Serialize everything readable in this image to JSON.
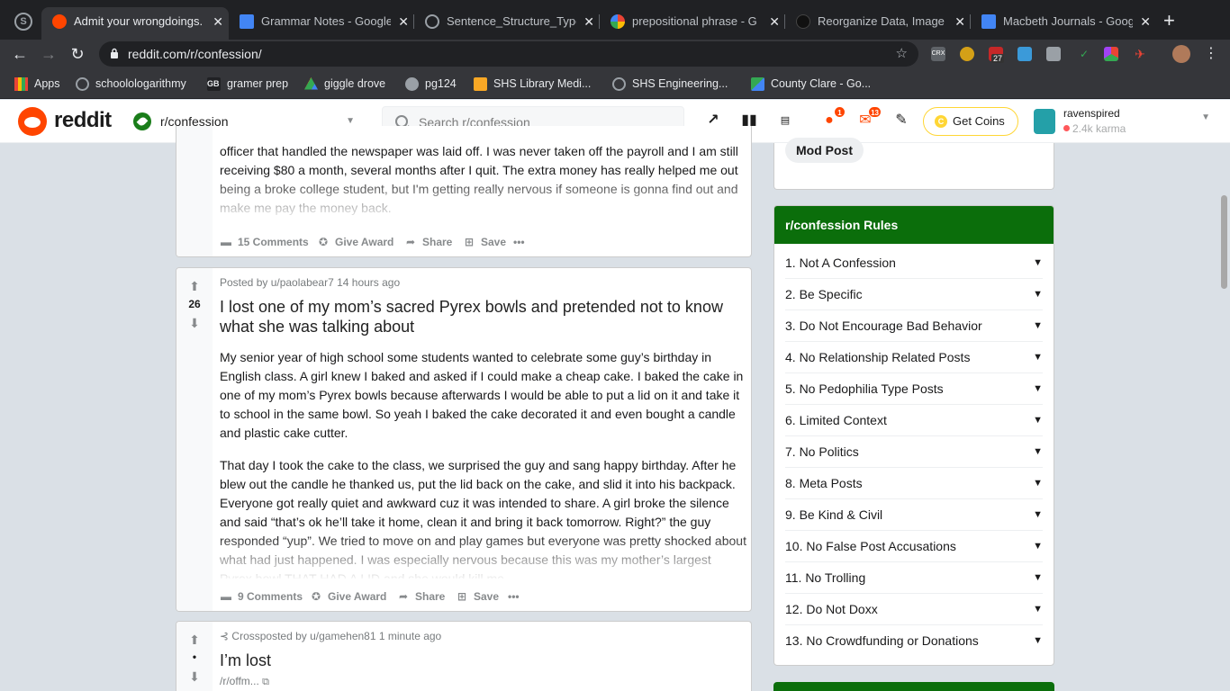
{
  "browser": {
    "tabs": [
      {
        "title": "Admit your wrongdoings.",
        "active": true,
        "favicon": "reddit-icon"
      },
      {
        "title": "Grammar Notes - Google",
        "favicon": "docs-icon"
      },
      {
        "title": "Sentence_Structure_Type",
        "favicon": "schoology-icon"
      },
      {
        "title": "prepositional phrase - G",
        "favicon": "google-icon"
      },
      {
        "title": "Reorganize Data, Image",
        "favicon": "github-icon"
      },
      {
        "title": "Macbeth Journals - Goog",
        "favicon": "docs-icon"
      }
    ],
    "url": "reddit.com/r/confession/",
    "extension_badge": "27",
    "bookmarks": [
      {
        "label": "Apps"
      },
      {
        "label": "schoolologarithmy"
      },
      {
        "label": "gramer prep"
      },
      {
        "label": "giggle drove"
      },
      {
        "label": "pg124"
      },
      {
        "label": "SHS Library Medi..."
      },
      {
        "label": "SHS Engineering..."
      },
      {
        "label": "County Clare - Go..."
      }
    ]
  },
  "header": {
    "wordmark": "reddit",
    "community": "r/confession",
    "search_placeholder": "Search r/confession",
    "chat_badge": "1",
    "mail_badge": "13",
    "get_coins": "Get Coins",
    "username": "ravenspired",
    "karma": "2.4k karma"
  },
  "feed": {
    "post1": {
      "body": "officer that handled the newspaper was laid off. I was never taken off the payroll and I am still receiving $80 a month, several months after I quit. The extra money has really helped me out being a broke college student, but I'm getting really nervous if someone is gonna find out and make me pay the money back.",
      "comments": "15 Comments",
      "award": "Give Award",
      "share": "Share",
      "save": "Save"
    },
    "post2": {
      "score": "26",
      "meta": "Posted by u/paolabear7 14 hours ago",
      "title": "I lost one of my mom’s sacred Pyrex bowls and pretended not to know what she was talking about",
      "para1": "My senior year of high school some students wanted to celebrate some guy’s birthday in English class. A girl knew I baked and asked if I could make a cheap cake. I baked the cake in one of my mom’s Pyrex bowls because afterwards I would be able to put a lid on it and take it to school in the same bowl. So yeah I baked the cake decorated it and even bought a candle and plastic cake cutter.",
      "para2": "That day I took the cake to the class, we surprised the guy and sang happy birthday. After he blew out the candle he thanked us, put the lid back on the cake, and slid it into his backpack. Everyone got really quiet and awkward cuz it was intended to share. A girl broke the silence and said “that’s ok he’ll take it home, clean it and bring it back tomorrow. Right?” the guy responded “yup”. We tried to move on and play games but everyone was pretty shocked about what had just happened. I was especially nervous because this was my mother’s largest Pyrex bowl THAT HAD A LID and she would kill me",
      "comments": "9 Comments",
      "award": "Give Award",
      "share": "Share",
      "save": "Save"
    },
    "post3": {
      "score": "•",
      "meta": "Crossposted by u/gamehen81 1 minute ago",
      "title": "I’m lost",
      "link": "/r/offm..."
    }
  },
  "sidebar": {
    "mod_post": "Mod Post",
    "rules_title": "r/confession Rules",
    "rules": [
      "1. Not A Confession",
      "2. Be Specific",
      "3. Do Not Encourage Bad Behavior",
      "4. No Relationship Related Posts",
      "5. No Pedophilia Type Posts",
      "6. Limited Context",
      "7. No Politics",
      "8. Meta Posts",
      "9. Be Kind & Civil",
      "10. No False Post Accusations",
      "11. No Trolling",
      "12. Do Not Doxx",
      "13. No Crowdfunding or Donations"
    ]
  },
  "colors": {
    "reddit_orange": "#ff4500",
    "rules_header": "#0b6e0b",
    "coin_yellow": "#ffd635"
  }
}
